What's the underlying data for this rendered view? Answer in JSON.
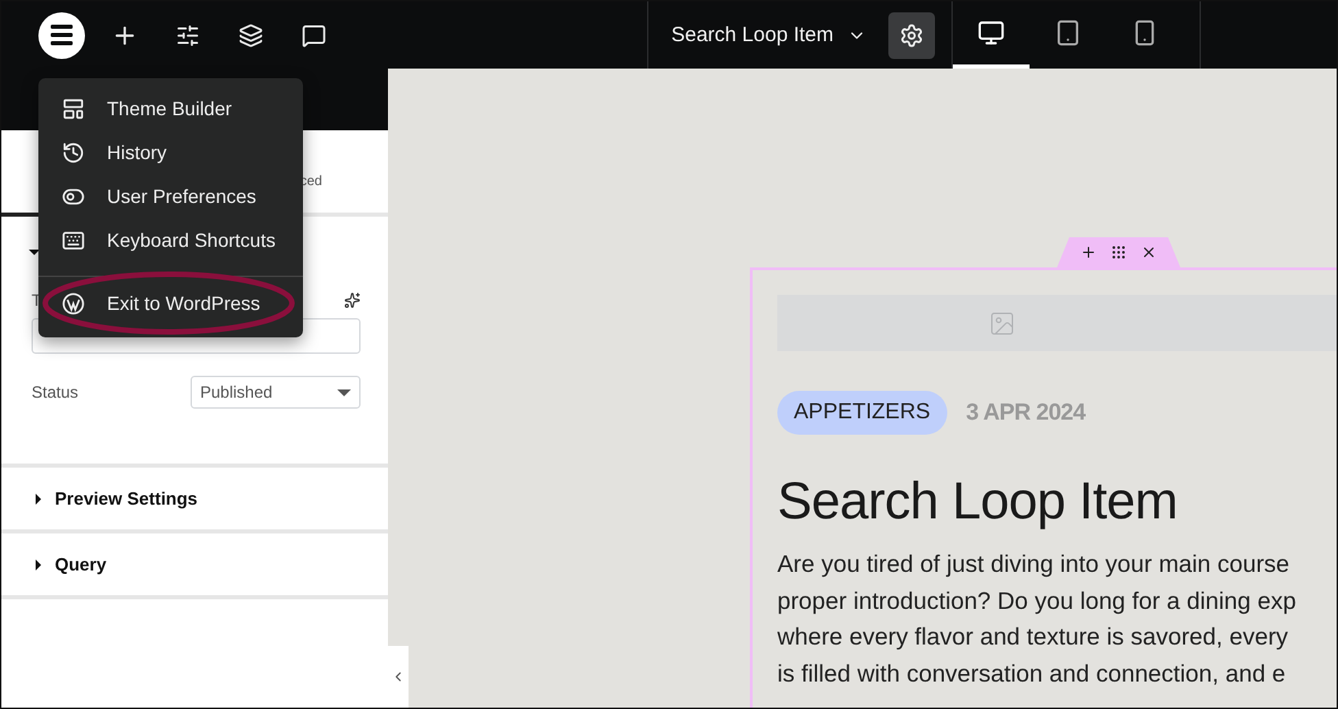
{
  "topbar": {
    "document_title": "Search Loop Item",
    "devices": [
      {
        "kind": "desktop",
        "selected": true
      },
      {
        "kind": "tablet",
        "selected": false
      },
      {
        "kind": "mobile",
        "selected": false
      }
    ]
  },
  "main_menu": {
    "items": [
      {
        "kind": "theme",
        "label": "Theme Builder",
        "highlighted": false
      },
      {
        "kind": "history",
        "label": "History",
        "highlighted": false
      },
      {
        "kind": "toggle",
        "label": "User Preferences",
        "highlighted": false
      },
      {
        "kind": "keyboard",
        "label": "Keyboard Shortcuts",
        "highlighted": false
      },
      {
        "kind": "wordpress",
        "label": "Exit to WordPress",
        "highlighted": true
      }
    ]
  },
  "panel": {
    "tab_fragment": "ced",
    "title_label_fragment": "T",
    "status_label": "Status",
    "status_value": "Published",
    "sections": [
      {
        "label": "Preview Settings",
        "expanded": false
      },
      {
        "label": "Query",
        "expanded": false
      }
    ]
  },
  "canvas": {
    "badge": "APPETIZERS",
    "date": "3 APR 2024",
    "heading": "Search Loop Item",
    "paragraph_lines": [
      "Are you tired of just diving into your main course",
      "proper introduction? Do you long for a dining exp",
      "where every flavor and texture is savored, every",
      "is filled with conversation and connection, and e"
    ]
  }
}
